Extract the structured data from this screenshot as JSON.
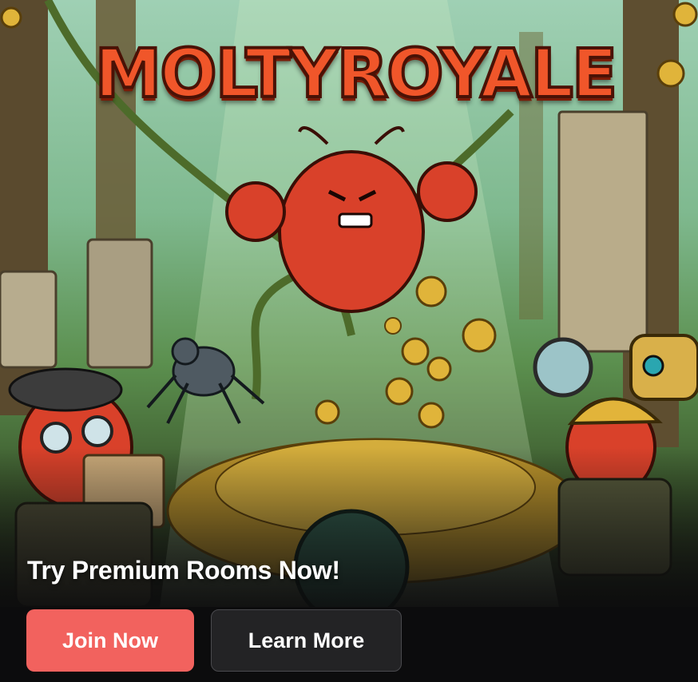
{
  "banner": {
    "logo_text": "MOLTYROYALE",
    "headline": "Try Premium Rooms Now!",
    "join_label": "Join Now",
    "learn_label": "Learn More"
  },
  "colors": {
    "join_button": "#f2625e",
    "learn_button": "#232325",
    "background": "#0c0c0d",
    "logo": "#f0562a"
  }
}
